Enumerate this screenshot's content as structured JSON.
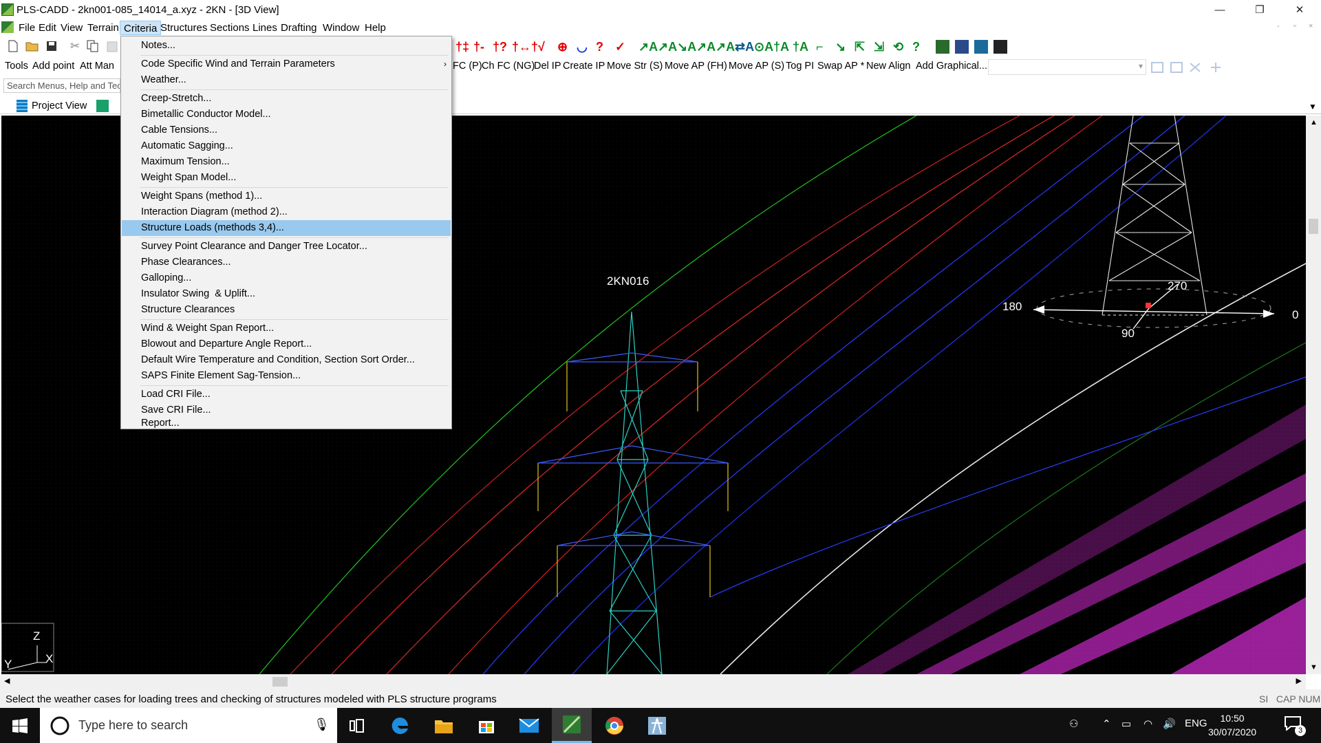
{
  "window": {
    "title": "PLS-CADD - 2kn001-085_14014_a.xyz - 2KN - [3D View]",
    "controls": {
      "minimize": "—",
      "restore": "❐",
      "close": "✕"
    }
  },
  "menubar": {
    "items": [
      "File",
      "Edit",
      "View",
      "Terrain",
      "Criteria",
      "Structures",
      "Sections",
      "Lines",
      "Drafting",
      "Window",
      "Help"
    ],
    "active": "Criteria",
    "mdi": [
      "-",
      "▫",
      "×"
    ]
  },
  "toolbar2": {
    "left_items": [
      "Tools",
      "Add point",
      "Att Man"
    ],
    "right_items": [
      "FC (P)",
      "Ch FC (NG)",
      "Del IP",
      "Create IP",
      "Move Str (S)",
      "Move AP (FH)",
      "Move AP (S)",
      "Tog PI",
      "Swap AP *",
      "New Align",
      "Add Graphical..."
    ]
  },
  "search": {
    "placeholder": "Search Menus, Help and Tec"
  },
  "tabs": {
    "project_view": "Project View"
  },
  "criteria_menu": {
    "items": [
      {
        "label": "Notes...",
        "submenu": false
      },
      {
        "label": "Code Specific Wind and Terrain Parameters",
        "submenu": true
      },
      {
        "label": "Weather...",
        "submenu": false
      },
      {
        "label": "Creep-Stretch...",
        "submenu": false
      },
      {
        "label": "Bimetallic Conductor Model...",
        "submenu": false
      },
      {
        "label": "Cable Tensions...",
        "submenu": false
      },
      {
        "label": "Automatic Sagging...",
        "submenu": false
      },
      {
        "label": "Maximum Tension...",
        "submenu": false
      },
      {
        "label": "Weight Span Model...",
        "submenu": false
      },
      {
        "label": "Weight Spans (method 1)...",
        "submenu": false
      },
      {
        "label": "Interaction Diagram (method 2)...",
        "submenu": false
      },
      {
        "label": "Structure Loads (methods 3,4)...",
        "submenu": false,
        "highlighted": true
      },
      {
        "label": "Survey Point Clearance and Danger Tree Locator...",
        "submenu": false
      },
      {
        "label": "Phase Clearances...",
        "submenu": false
      },
      {
        "label": "Galloping...",
        "submenu": false
      },
      {
        "label": "Insulator Swing  & Uplift...",
        "submenu": false
      },
      {
        "label": "Structure Clearances",
        "submenu": false
      },
      {
        "label": "Wind & Weight Span Report...",
        "submenu": false
      },
      {
        "label": "Blowout and Departure Angle Report...",
        "submenu": false
      },
      {
        "label": "Default Wire Temperature and Condition, Section Sort Order...",
        "submenu": false
      },
      {
        "label": "SAPS Finite Element Sag-Tension...",
        "submenu": false
      },
      {
        "label": "Load CRI File...",
        "submenu": false
      },
      {
        "label": "Save CRI File...",
        "submenu": false
      },
      {
        "label": "Report...",
        "submenu": false
      }
    ]
  },
  "viewport": {
    "structure_label": "2KN016",
    "compass": {
      "w": "180",
      "e": "0",
      "n": "270",
      "s": "90"
    },
    "axes": {
      "z": "Z",
      "x": "X",
      "y": "Y"
    }
  },
  "statusbar": {
    "message": "Select the weather cases for loading trees and checking of structures modeled with PLS structure programs",
    "right": "SI   CAP NUM"
  },
  "taskbar": {
    "search_placeholder": "Type here to search",
    "lang": "ENG",
    "time": "10:50",
    "date": "30/07/2020",
    "notifications": "3"
  },
  "colors": {
    "menu_highlight": "#99c9ef",
    "active_menu": "#cce4f7",
    "canvas_bg": "#000000",
    "tower_near": "#2bd3c5",
    "conductor_red": "#ff2a2a",
    "conductor_blue": "#2a3bff",
    "vegetation_magenta": "#ff33ff"
  }
}
